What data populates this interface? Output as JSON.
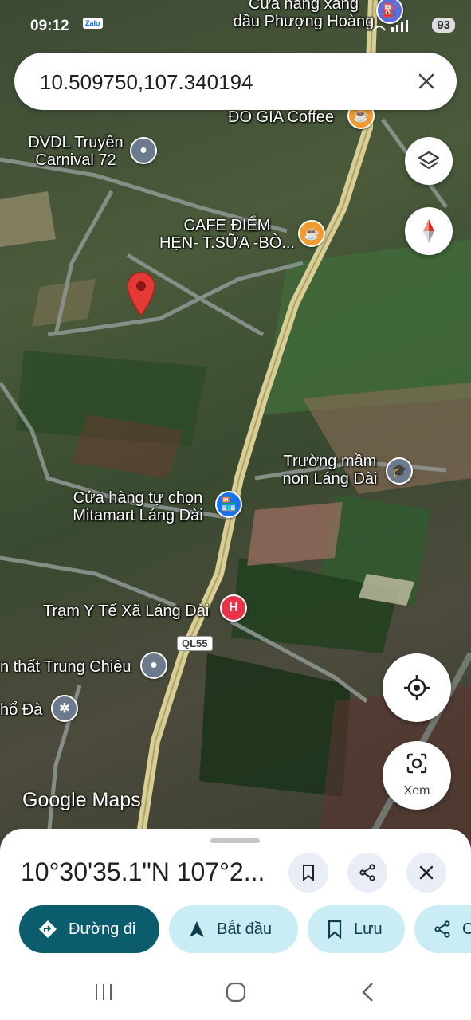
{
  "status_bar": {
    "time": "09:12",
    "notification_app": "Zalo",
    "battery": "93"
  },
  "search": {
    "query": "10.509750,107.340194"
  },
  "map": {
    "pois": [
      {
        "name": "Cửa hàng xăng dầu Phượng Hoàng",
        "line1": "Cửa hàng xăng",
        "line2": "dầu Phượng Hoàng",
        "icon": "gas-station-icon",
        "color": "#5b6ee1"
      },
      {
        "name": "ĐÔ GIA Coffee",
        "line1": "ĐÔ GIA Coffee",
        "icon": "coffee-icon",
        "color": "#f29a2e"
      },
      {
        "name": "DVDL Truyền Carnival 72",
        "line1": "DVDL Truyền",
        "line2": "Carnival 72",
        "icon": "place-icon",
        "color": "#6b7a8c"
      },
      {
        "name": "CAFE ĐIỂM HẸN- T.SỮA -BÒ...",
        "line1": "CAFE ĐIỂM",
        "line2": "HẸN- T.SỮA -BÒ...",
        "icon": "coffee-icon",
        "color": "#f29a2e"
      },
      {
        "name": "Trường mầm non Láng Dài",
        "line1": "Trường mầm",
        "line2": "non Láng Dài",
        "icon": "school-icon",
        "color": "#6b7a8c"
      },
      {
        "name": "Cửa hàng tự chọn Mitamart Láng Dài",
        "line1": "Cửa hàng tự chọn",
        "line2": "Mitamart Láng Dài",
        "icon": "shopping-icon",
        "color": "#1a73e8"
      },
      {
        "name": "Trạm Y Tế Xã Láng Dài",
        "line1": "Trạm Y Tế Xã Láng Dài",
        "icon": "hospital-icon",
        "color": "#e8334a"
      },
      {
        "name": "n thất Trung Chiêu",
        "line1": "n thất Trung Chiêu",
        "icon": "place-icon",
        "color": "#6b7a8c"
      },
      {
        "name": "hổ Đà",
        "line1": "hổ Đà",
        "icon": "temple-icon",
        "color": "#6b7a8c"
      }
    ],
    "road_shield": "QL55",
    "branding": "Google Maps"
  },
  "controls": {
    "layers_icon": "layers-icon",
    "compass_icon": "compass-icon",
    "my_location_icon": "my-location-icon",
    "lens_label": "Xem"
  },
  "sheet": {
    "coordinate_title": "10°30'35.1\"N 107°2...",
    "actions": [
      {
        "label": "Đường đi",
        "icon": "directions-icon",
        "primary": true
      },
      {
        "label": "Bắt đầu",
        "icon": "navigation-icon",
        "primary": false
      },
      {
        "label": "Lưu",
        "icon": "bookmark-icon",
        "primary": false
      },
      {
        "label": "C",
        "icon": "share-icon",
        "primary": false
      }
    ]
  },
  "colors": {
    "primary": "#0b5d6e",
    "secondary_chip": "#c9ecf5",
    "pin": "#e53935"
  }
}
